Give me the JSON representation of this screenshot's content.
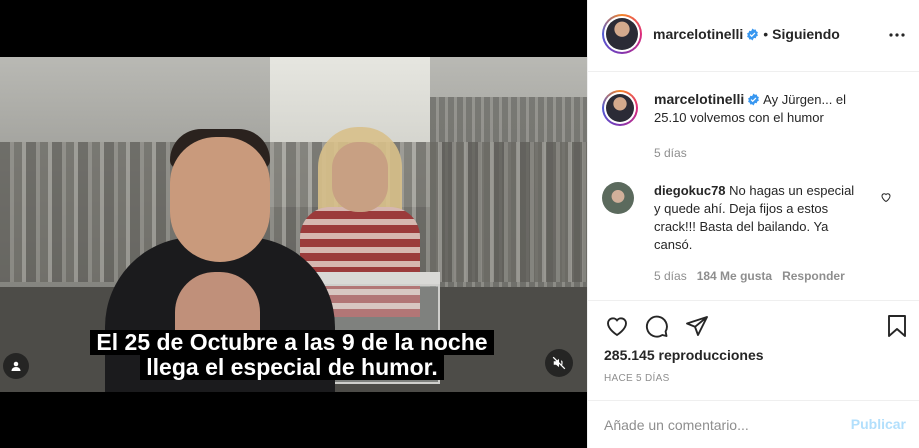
{
  "video": {
    "subtitle_line1": "El 25 de Octubre a las 9 de la noche",
    "subtitle_line2": "llega el especial de humor.",
    "tag_icon": "user-tag-icon",
    "mute_icon": "muted-speaker-icon"
  },
  "header": {
    "username": "marcelotinelli",
    "separator": "•",
    "follow_status": "Siguiendo",
    "more_icon": "more-horizontal-icon"
  },
  "caption": {
    "username": "marcelotinelli",
    "text": "Ay Jürgen... el 25.10 volvemos con el humor",
    "time": "5 días"
  },
  "comments": [
    {
      "username": "diegokuc78",
      "text": "No hagas un especial y quede ahí. Deja fijos a estos crack!!! Basta del bailando. Ya cansó.",
      "time": "5 días",
      "likes": "184 Me gusta",
      "reply": "Responder"
    }
  ],
  "stats": {
    "views": "285.145 reproducciones",
    "ago": "HACE 5 DÍAS"
  },
  "composer": {
    "placeholder": "Añade un comentario...",
    "publish": "Publicar"
  },
  "colors": {
    "verified": "#3897f0",
    "publish_disabled": "#b2dffc",
    "muted_text": "#8e8e8e",
    "divider": "#efefef"
  }
}
